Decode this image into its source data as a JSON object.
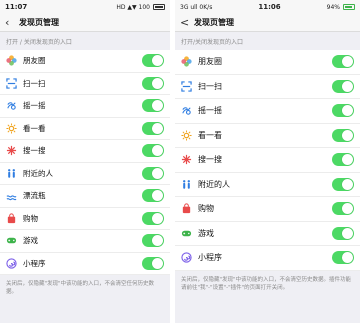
{
  "left": {
    "status": {
      "time": "11:07",
      "indicators": "HD ▲▼ 100"
    },
    "nav": {
      "back": "‹",
      "title": "发现页管理"
    },
    "section_label": "打开 / 关闭发现页的入口",
    "items": [
      {
        "label": "朋友圈",
        "icon": "moments-icon",
        "enabled": true
      },
      {
        "label": "扫一扫",
        "icon": "scan-icon",
        "enabled": true
      },
      {
        "label": "摇一摇",
        "icon": "shake-icon",
        "enabled": true
      },
      {
        "label": "看一看",
        "icon": "top-stories-icon",
        "enabled": true
      },
      {
        "label": "搜一搜",
        "icon": "search-icon",
        "enabled": true
      },
      {
        "label": "附近的人",
        "icon": "people-nearby-icon",
        "enabled": true
      },
      {
        "label": "漂流瓶",
        "icon": "drift-bottle-icon",
        "enabled": true
      },
      {
        "label": "购物",
        "icon": "shopping-icon",
        "enabled": true
      },
      {
        "label": "游戏",
        "icon": "games-icon",
        "enabled": true
      },
      {
        "label": "小程序",
        "icon": "mini-programs-icon",
        "enabled": true
      }
    ],
    "footer": "关闭后，仅隐藏\"发现\"中该功能的入口，不会清空任何历史数据。"
  },
  "right": {
    "status": {
      "left": "3G ull 0K/s",
      "time": "11:06",
      "battery": "94%"
    },
    "nav": {
      "back": "<",
      "title": "发现页管理"
    },
    "section_label": "打开/关闭发现页的入口",
    "items": [
      {
        "label": "朋友圈",
        "icon": "moments-icon",
        "enabled": true
      },
      {
        "label": "扫一扫",
        "icon": "scan-icon",
        "enabled": true
      },
      {
        "label": "摇一摇",
        "icon": "shake-icon",
        "enabled": true
      },
      {
        "label": "看一看",
        "icon": "top-stories-icon",
        "enabled": true
      },
      {
        "label": "搜一搜",
        "icon": "search-icon",
        "enabled": true
      },
      {
        "label": "附近的人",
        "icon": "people-nearby-icon",
        "enabled": true
      },
      {
        "label": "购物",
        "icon": "shopping-icon",
        "enabled": true
      },
      {
        "label": "游戏",
        "icon": "games-icon",
        "enabled": true
      },
      {
        "label": "小程序",
        "icon": "mini-programs-icon",
        "enabled": true
      }
    ],
    "footer": "关闭后，仅隐藏\"发现\"中该功能的入口，不会清空历史数据。插件功能请前往\"我\"-\"设置\"-\"插件\"的页面打开关闭。"
  },
  "colors": {
    "toggle_on": "#4cd964",
    "background": "#efeff4",
    "text_secondary": "#8a8a8a"
  }
}
